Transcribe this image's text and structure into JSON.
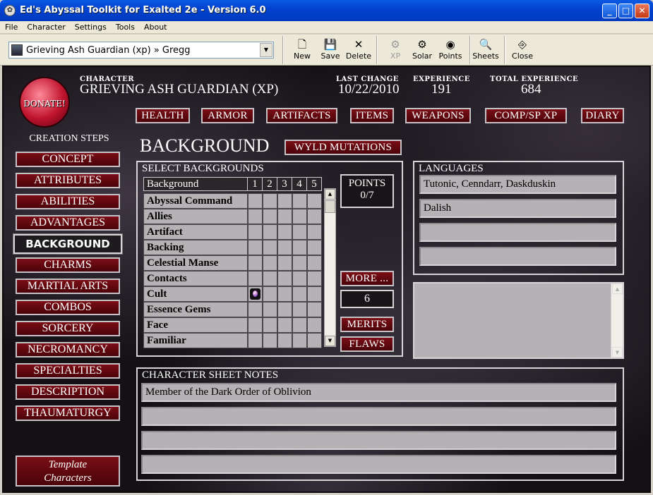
{
  "window": {
    "title": "Ed's Abyssal Toolkit for Exalted 2e - Version 6.0",
    "min": "_",
    "max": "□",
    "close": "✕"
  },
  "menu": [
    "File",
    "Character",
    "Settings",
    "Tools",
    "About"
  ],
  "toolbar": {
    "character_select": "Grieving Ash Guardian (xp) » Gregg",
    "buttons": [
      {
        "label": "New",
        "icon": "new-document-icon",
        "glyph": "🗋",
        "enabled": true
      },
      {
        "label": "Save",
        "icon": "floppy-disk-icon",
        "glyph": "💾",
        "enabled": true
      },
      {
        "label": "Delete",
        "icon": "delete-x-icon",
        "glyph": "✕",
        "enabled": true
      },
      {
        "label": "XP",
        "icon": "xp-gear-icon",
        "glyph": "⚙",
        "enabled": false
      },
      {
        "label": "Solar",
        "icon": "solar-gear-icon",
        "glyph": "⚙",
        "enabled": true
      },
      {
        "label": "Points",
        "icon": "points-gem-icon",
        "glyph": "◉",
        "enabled": true
      },
      {
        "label": "Sheets",
        "icon": "sheets-magnifier-icon",
        "glyph": "🔍",
        "enabled": true
      },
      {
        "label": "Close",
        "icon": "exit-door-icon",
        "glyph": "⎆",
        "enabled": true
      }
    ]
  },
  "header": {
    "donate": "DONATE!",
    "character_label": "CHARACTER",
    "character_value": "GRIEVING ASH GUARDIAN (XP)",
    "last_change_label": "LAST CHANGE",
    "last_change_value": "10/22/2010",
    "experience_label": "EXPERIENCE",
    "experience_value": "191",
    "total_exp_label": "TOTAL EXPERIENCE",
    "total_exp_value": "684"
  },
  "top_tabs": [
    "Health",
    "Armor",
    "Artifacts",
    "Items",
    "Weapons",
    "Comp/Sp XP",
    "Diary"
  ],
  "sidebar": {
    "title": "Creation Steps",
    "items": [
      "Concept",
      "Attributes",
      "Abilities",
      "Advantages",
      "Background",
      "Charms",
      "Martial Arts",
      "Combos",
      "Sorcery",
      "Necromancy",
      "Specialties",
      "Description",
      "Thaumaturgy"
    ],
    "active": "Background",
    "template_line1": "Template",
    "template_line2": "Characters"
  },
  "page": {
    "title": "Background",
    "wyld_button": "Wyld Mutations",
    "select_title": "Select Backgrounds",
    "grid_headers": [
      "Background",
      "1",
      "2",
      "3",
      "4",
      "5"
    ],
    "rows": [
      {
        "name": "Abyssal Command",
        "dots": 0
      },
      {
        "name": "Allies",
        "dots": 0
      },
      {
        "name": "Artifact",
        "dots": 0
      },
      {
        "name": "Backing",
        "dots": 0
      },
      {
        "name": "Celestial Manse",
        "dots": 0
      },
      {
        "name": "Contacts",
        "dots": 0
      },
      {
        "name": "Cult",
        "dots": 1
      },
      {
        "name": "Essence Gems",
        "dots": 0
      },
      {
        "name": "Face",
        "dots": 0
      },
      {
        "name": "Familiar",
        "dots": 0
      }
    ],
    "points_label": "POINTS",
    "points_value": "0/7",
    "more_button": "More ...",
    "more_value": "6",
    "merits_button": "Merits",
    "flaws_button": "Flaws",
    "languages_title": "Languages",
    "languages": [
      "Tutonic, Cenndarr, Daskduskin",
      "Dalish",
      "",
      ""
    ],
    "notes_title": "Character Sheet Notes",
    "notes": [
      "Member of the Dark Order of Oblivion",
      "",
      "",
      ""
    ]
  }
}
